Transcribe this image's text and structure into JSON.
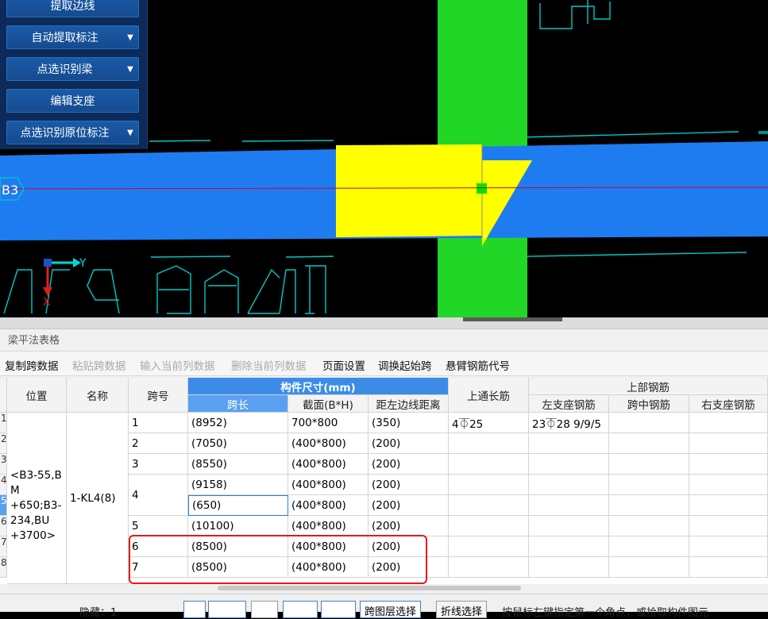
{
  "tool_panel": {
    "buttons": [
      {
        "label": "提取边线",
        "has_dropdown": false
      },
      {
        "label": "自动提取标注",
        "has_dropdown": true
      },
      {
        "label": "点选识别梁",
        "has_dropdown": true
      },
      {
        "label": "编辑支座",
        "has_dropdown": false
      },
      {
        "label": "点选识别原位标注",
        "has_dropdown": true
      }
    ],
    "dropdown_glyph": "▼"
  },
  "canvas": {
    "beam_label": "B3",
    "axis_y_label": "Y",
    "axis_x_label": "X",
    "colors": {
      "beam": "#1e7cf0",
      "column": "#22d628",
      "highlight": "#ffff00",
      "lines": "#00c8c8",
      "axis_line": "#c8003c"
    }
  },
  "table_panel": {
    "title": "梁平法表格",
    "toolbar": [
      {
        "label": "复制跨数据",
        "enabled": true
      },
      {
        "label": "粘贴跨数据",
        "enabled": false
      },
      {
        "label": "输入当前列数据",
        "enabled": false
      },
      {
        "label": "删除当前列数据",
        "enabled": false
      },
      {
        "label": "页面设置",
        "enabled": true
      },
      {
        "label": "调换起始跨",
        "enabled": true
      },
      {
        "label": "悬臂钢筋代号",
        "enabled": true
      }
    ],
    "headers": {
      "position": "位置",
      "name": "名称",
      "span_no": "跨号",
      "dimensions_group": "构件尺寸(mm)",
      "span_length": "跨长",
      "section": "截面(B*H)",
      "dist_left_edge": "距左边线距离",
      "top_through": "上通长筋",
      "top_rebar_group": "上部钢筋",
      "left_support": "左支座钢筋",
      "mid_span": "跨中钢筋",
      "right_support": "右支座钢筋"
    },
    "position_value": "<B3-55,B\nM\n+650;B3-\n234,BU\n+3700>",
    "name_value": "1-KL4(8)",
    "row_numbers": [
      "1",
      "2",
      "3",
      "4",
      "5",
      "6",
      "7",
      "8"
    ],
    "selected_row": "5",
    "rows": [
      {
        "span": "1",
        "length": "(8952)",
        "section": "700*800",
        "dist": "(350)",
        "top_through": "4⏁25",
        "left_support": "23⏁28 9/9/5"
      },
      {
        "span": "2",
        "length": "(7050)",
        "section": "(400*800)",
        "dist": "(200)",
        "top_through": "",
        "left_support": ""
      },
      {
        "span": "3",
        "length": "(8550)",
        "section": "(400*800)",
        "dist": "(200)",
        "top_through": "",
        "left_support": ""
      },
      {
        "span": "4",
        "length": "(9158)",
        "section": "(400*800)",
        "dist": "(200)",
        "top_through": "",
        "left_support": ""
      },
      {
        "span": "",
        "length": "(650)",
        "section": "(400*800)",
        "dist": "(200)",
        "top_through": "",
        "left_support": ""
      },
      {
        "span": "5",
        "length": "(10100)",
        "section": "(400*800)",
        "dist": "(200)",
        "top_through": "",
        "left_support": ""
      },
      {
        "span": "6",
        "length": "(8500)",
        "section": "(400*800)",
        "dist": "(200)",
        "top_through": "",
        "left_support": ""
      },
      {
        "span": "7",
        "length": "(8500)",
        "section": "(400*800)",
        "dist": "(200)",
        "top_through": "",
        "left_support": ""
      }
    ]
  },
  "statusbar": {
    "hidden_label": "隐藏：1",
    "layer_select": "跨图层选择",
    "polyline_select": "折线选择",
    "hint": "按鼠标左键指定第一个角点，或拾取构件图元"
  }
}
